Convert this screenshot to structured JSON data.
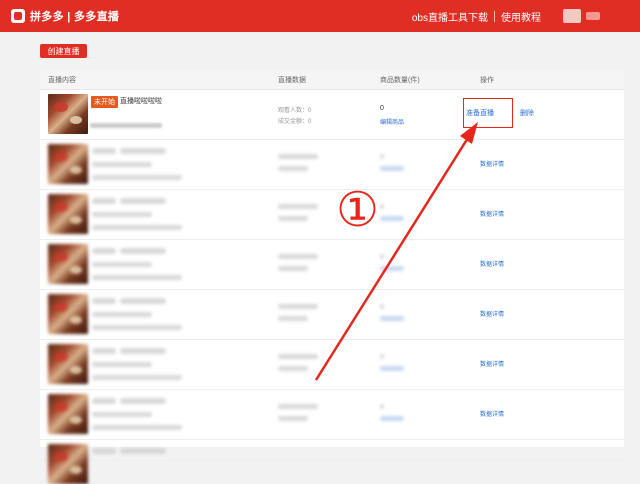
{
  "header": {
    "brand": "拼多多 | 多多直播",
    "links": [
      "obs直播工具下载",
      "使用教程"
    ]
  },
  "toolbar": {
    "create_label": "创建直播"
  },
  "table": {
    "columns": [
      "直播内容",
      "直播数据",
      "商品数量(件)",
      "操作"
    ],
    "first_row": {
      "status_badge": "未开始",
      "title": "直播啦啦啦啦",
      "viewers": "观看人数：0",
      "sales": "成交金额：0",
      "goods_count": "0",
      "edit_goods": "编辑商品",
      "prepare": "准备直播",
      "delete": "删除"
    },
    "other_rows_action": "数据详情"
  },
  "annotation": {
    "step": "①",
    "color": "#e8261c"
  },
  "colors": {
    "accent": "#e02e24",
    "link": "#2d6fd2"
  }
}
